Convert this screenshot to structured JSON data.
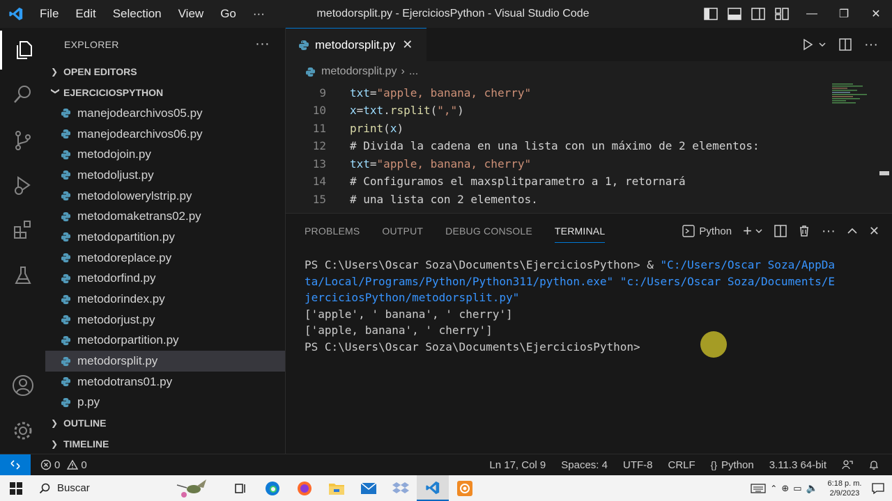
{
  "window": {
    "title": "metodorsplit.py - EjerciciosPython - Visual Studio Code",
    "menu": [
      "File",
      "Edit",
      "Selection",
      "View",
      "Go"
    ],
    "menu_more": "···"
  },
  "sidebar": {
    "header": "EXPLORER",
    "more": "···",
    "open_editors": "OPEN EDITORS",
    "folder": "EJERCICIOSPYTHON",
    "files": [
      "manejodearchivos05.py",
      "manejodearchivos06.py",
      "metodojoin.py",
      "metodoljust.py",
      "metodolowerylstrip.py",
      "metodomaketrans02.py",
      "metodopartition.py",
      "metodoreplace.py",
      "metodorfind.py",
      "metodorindex.py",
      "metodorjust.py",
      "metodorpartition.py",
      "metodorsplit.py",
      "metodotrans01.py",
      "p.py"
    ],
    "selected_file": "metodorsplit.py",
    "outline": "OUTLINE",
    "timeline": "TIMELINE"
  },
  "editor": {
    "tab_name": "metodorsplit.py",
    "breadcrumb_file": "metodorsplit.py",
    "breadcrumb_more": "...",
    "lines": [
      {
        "num": "9",
        "text": "txt=\"apple, banana, cherry\""
      },
      {
        "num": "10",
        "text": "x=txt.rsplit(\",\")"
      },
      {
        "num": "11",
        "text": "print(x)"
      },
      {
        "num": "12",
        "text": "# Divida la cadena en una lista con un máximo de 2 elementos:"
      },
      {
        "num": "13",
        "text": "txt=\"apple, banana, cherry\""
      },
      {
        "num": "14",
        "text": "# Configuramos el maxsplitparametro a 1, retornará"
      },
      {
        "num": "15",
        "text": "# una lista con 2 elementos."
      }
    ]
  },
  "panel": {
    "tabs": [
      "PROBLEMS",
      "OUTPUT",
      "DEBUG CONSOLE",
      "TERMINAL"
    ],
    "active_tab": "TERMINAL",
    "shell": "Python",
    "terminal_lines": [
      {
        "prompt": "PS C:\\Users\\Oscar Soza\\Documents\\EjerciciosPython> & ",
        "str": "\"C:/Users/Oscar Soza/AppDa"
      },
      {
        "prompt": "",
        "str": "ta/Local/Programs/Python/Python311/python.exe\" \"c:/Users/Oscar Soza/Documents/E"
      },
      {
        "prompt": "",
        "str": "jerciciosPython/metodorsplit.py\""
      },
      {
        "prompt": "['apple', ' banana', ' cherry']",
        "str": ""
      },
      {
        "prompt": "['apple, banana', ' cherry']",
        "str": ""
      },
      {
        "prompt": "PS C:\\Users\\Oscar Soza\\Documents\\EjerciciosPython>",
        "str": ""
      }
    ]
  },
  "statusbar": {
    "errors": "0",
    "warnings": "0",
    "position": "Ln 17, Col 9",
    "spaces": "Spaces: 4",
    "encoding": "UTF-8",
    "eol": "CRLF",
    "language": "Python",
    "interpreter": "3.11.3 64-bit"
  },
  "taskbar": {
    "search_placeholder": "Buscar",
    "time": "6:18 p. m.",
    "date": "2/9/2023"
  },
  "colors": {
    "accent": "#0078d4",
    "python_icon": "#519aba"
  }
}
